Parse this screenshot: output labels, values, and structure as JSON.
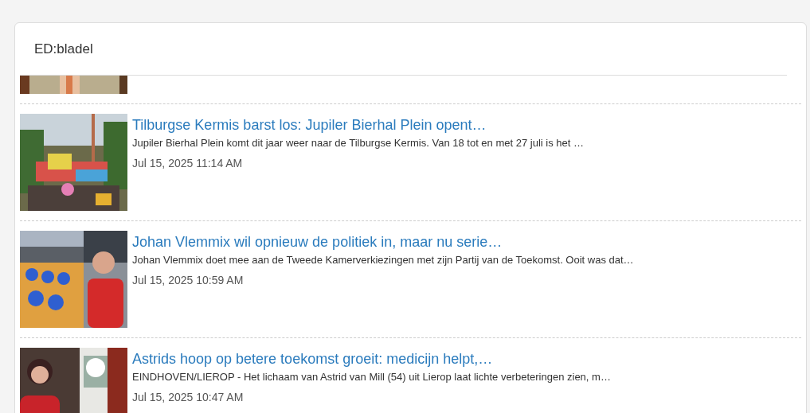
{
  "panel": {
    "title": "ED:bladel"
  },
  "articles": [
    {
      "title": "Tilburgse Kermis barst los: Jupiler Bierhal Plein opent…",
      "excerpt": "Jupiler Bierhal Plein komt dit jaar weer naar de Tilburgse Kermis. Van 18 tot en met 27 juli is het …",
      "date": "Jul 15, 2025 11:14 AM"
    },
    {
      "title": "Johan Vlemmix wil opnieuw de politiek in, maar nu serie…",
      "excerpt": "Johan Vlemmix doet mee aan de Tweede Kamerverkiezingen met zijn Partij van de Toekomst. Ooit was dat…",
      "date": "Jul 15, 2025 10:59 AM"
    },
    {
      "title": "Astrids hoop op betere toekomst groeit: medicijn helpt,…",
      "excerpt": "EINDHOVEN/LIEROP - Het lichaam van Astrid van Mill (54) uit Lierop laat lichte verbeteringen zien, m…",
      "date": "Jul 15, 2025 10:47 AM"
    }
  ]
}
